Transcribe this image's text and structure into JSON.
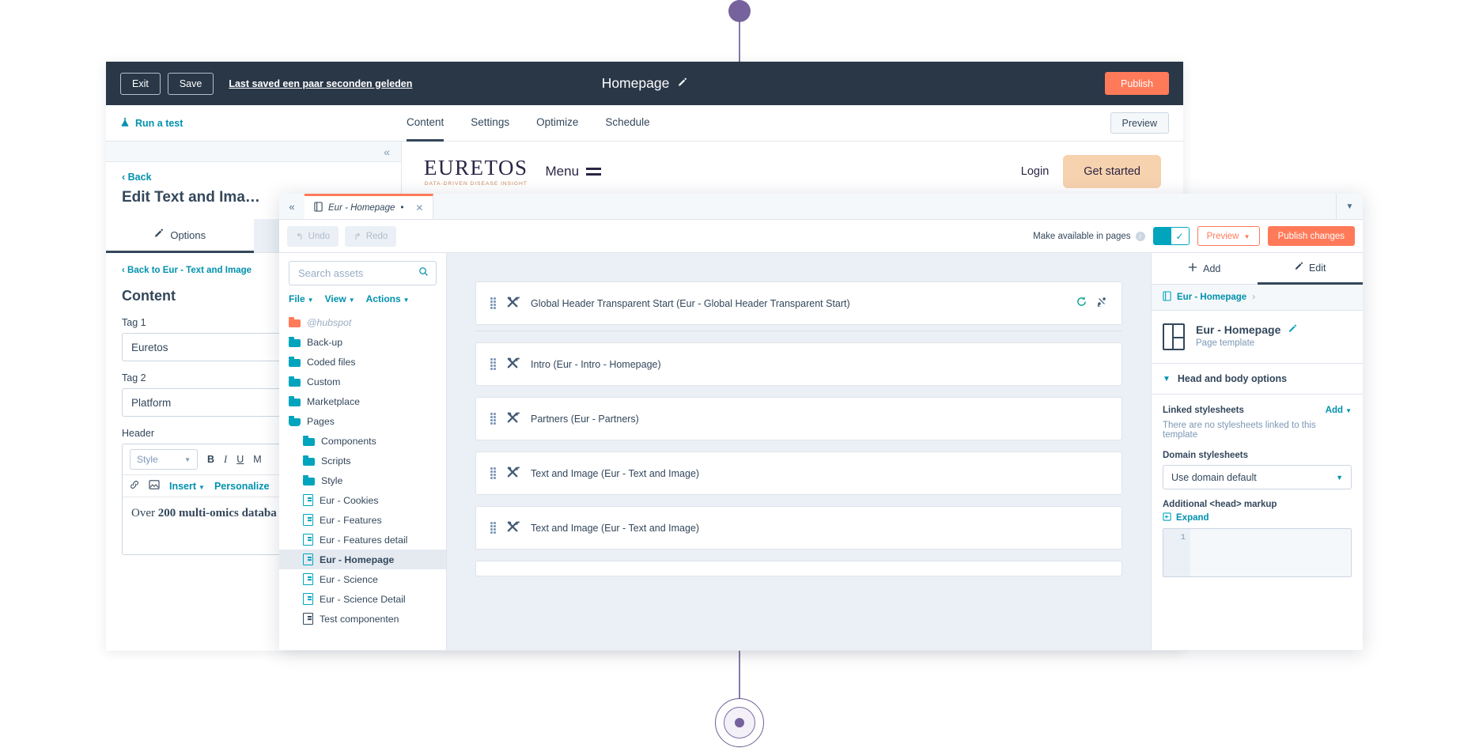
{
  "page_editor": {
    "topbar": {
      "exit_label": "Exit",
      "save_label": "Save",
      "saved_status": "Last saved een paar seconden geleden",
      "title": "Homepage",
      "edit_title_icon": "pencil-icon",
      "publish_label": "Publish"
    },
    "navbar": {
      "run_test_label": "Run a test",
      "run_test_icon": "flask-icon",
      "tabs": [
        {
          "label": "Content",
          "active": true
        },
        {
          "label": "Settings",
          "active": false
        },
        {
          "label": "Optimize",
          "active": false
        },
        {
          "label": "Schedule",
          "active": false
        }
      ],
      "preview_label": "Preview"
    },
    "sidebar": {
      "collapse_icon": "chevron-double-left-icon",
      "back_label": "‹  Back",
      "title": "Edit Text and Ima…",
      "tabs": [
        {
          "label": "Options",
          "icon": "pencil-icon",
          "active": true
        },
        {
          "label": "",
          "icon": "",
          "active": false
        }
      ],
      "back_to_module": "‹  Back to Eur - Text and Image",
      "section_heading": "Content",
      "fields": [
        {
          "label": "Tag 1",
          "value": "Euretos"
        },
        {
          "label": "Tag 2",
          "value": "Platform"
        }
      ],
      "rich_text": {
        "label": "Header",
        "style_select": "Style",
        "bold": "B",
        "italic": "I",
        "underline": "U",
        "more": "M",
        "link_icon": "link-icon",
        "image_icon": "image-icon",
        "insert_label": "Insert",
        "personalize_label": "Personalize",
        "body_prefix": "Over ",
        "body_bold": "200 multi-omics databa"
      }
    },
    "site_preview": {
      "logo": "EURETOS",
      "logo_tagline": "DATA-DRIVEN DISEASE INSIGHT",
      "menu_label": "Menu",
      "menu_icon": "hamburger-icon",
      "login_label": "Login",
      "cta_label": "Get started"
    }
  },
  "design_manager": {
    "tab": {
      "collapse_icon": "chevron-double-left-icon",
      "file_icon": "file-icon",
      "name": "Eur - Homepage",
      "dirty_marker": "•",
      "close_icon": "close-icon",
      "dropdown_icon": "chevron-down-icon"
    },
    "toolbar": {
      "undo_label": "Undo",
      "redo_label": "Redo",
      "available_label": "Make available in pages",
      "info_icon": "info-icon",
      "toggle_state": "on",
      "toggle_icon": "check-icon",
      "preview_label": "Preview",
      "publish_label": "Publish changes"
    },
    "tree": {
      "search_placeholder": "Search assets",
      "search_icon": "search-icon",
      "menus": [
        "File",
        "View",
        "Actions"
      ],
      "items": [
        {
          "label": "@hubspot",
          "type": "folder",
          "color": "orange",
          "muted": true,
          "indent": 0
        },
        {
          "label": "Back-up",
          "type": "folder",
          "indent": 0
        },
        {
          "label": "Coded files",
          "type": "folder",
          "indent": 0
        },
        {
          "label": "Custom",
          "type": "folder",
          "indent": 0
        },
        {
          "label": "Marketplace",
          "type": "folder",
          "indent": 0
        },
        {
          "label": "Pages",
          "type": "folder-open",
          "indent": 0
        },
        {
          "label": "Components",
          "type": "folder",
          "indent": 1
        },
        {
          "label": "Scripts",
          "type": "folder",
          "indent": 1
        },
        {
          "label": "Style",
          "type": "folder",
          "indent": 1
        },
        {
          "label": "Eur - Cookies",
          "type": "file",
          "indent": 1
        },
        {
          "label": "Eur - Features",
          "type": "file",
          "indent": 1
        },
        {
          "label": "Eur - Features detail",
          "type": "file",
          "indent": 1
        },
        {
          "label": "Eur - Homepage",
          "type": "file",
          "indent": 1,
          "selected": true
        },
        {
          "label": "Eur - Science",
          "type": "file",
          "indent": 1
        },
        {
          "label": "Eur - Science Detail",
          "type": "file",
          "indent": 1
        },
        {
          "label": "Test componenten",
          "type": "file",
          "indent": 1
        }
      ]
    },
    "modules": [
      {
        "label": "Global Header Transparent Start (Eur - Global Header Transparent Start)",
        "icon": "module-icon",
        "actions": [
          "refresh-icon",
          "unlink-icon"
        ]
      },
      {
        "label": "Intro (Eur - Intro - Homepage)",
        "icon": "module-icon",
        "actions": []
      },
      {
        "label": "Partners (Eur - Partners)",
        "icon": "module-icon",
        "actions": []
      },
      {
        "label": "Text and Image (Eur - Text and Image)",
        "icon": "module-icon",
        "actions": []
      },
      {
        "label": "Text and Image (Eur - Text and Image)",
        "icon": "module-icon",
        "actions": []
      }
    ],
    "inspector": {
      "tabs": [
        {
          "label": "Add",
          "icon": "plus-icon",
          "active": false
        },
        {
          "label": "Edit",
          "icon": "pencil-icon",
          "active": true
        }
      ],
      "breadcrumb": "Eur - Homepage",
      "breadcrumb_chevron": "›",
      "breadcrumb_icon": "file-icon",
      "card_title": "Eur - Homepage",
      "card_subtitle": "Page template",
      "card_edit_icon": "pencil-icon",
      "card_icon": "page-template-icon",
      "section_title": "Head and body options",
      "section_chevron": "chevron-down-icon",
      "linked_stylesheets_label": "Linked stylesheets",
      "linked_add_label": "Add",
      "linked_note": "There are no stylesheets linked to this template",
      "domain_stylesheets_label": "Domain stylesheets",
      "domain_value": "Use domain default",
      "head_markup_label": "Additional <head> markup",
      "expand_label": "Expand",
      "expand_icon": "expand-icon",
      "code_line_number": "1"
    }
  },
  "annotations": {
    "top_pin": "callout-dot",
    "bottom_pin": "callout-target"
  }
}
